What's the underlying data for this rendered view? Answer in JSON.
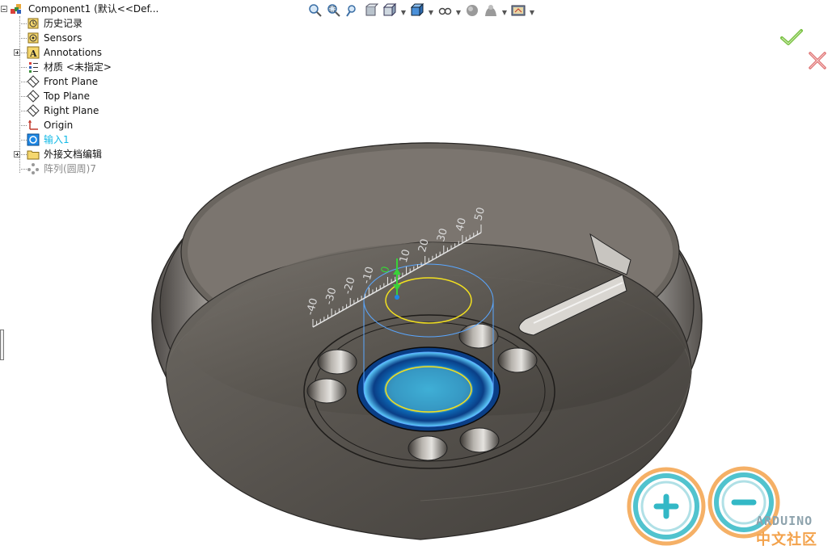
{
  "tree": {
    "root": "Component1  (默认<<Def...",
    "items": [
      {
        "label": "历史记录",
        "icon": "history-icon"
      },
      {
        "label": "Sensors",
        "icon": "sensors-icon"
      },
      {
        "label": "Annotations",
        "icon": "annotations-icon",
        "expandable": true
      },
      {
        "label": "材质 <未指定>",
        "icon": "material-icon"
      },
      {
        "label": "Front Plane",
        "icon": "plane-icon"
      },
      {
        "label": "Top Plane",
        "icon": "plane-icon"
      },
      {
        "label": "Right Plane",
        "icon": "plane-icon"
      },
      {
        "label": "Origin",
        "icon": "origin-icon"
      },
      {
        "label": "输入1",
        "icon": "imported-body-icon",
        "state": "selected"
      },
      {
        "label": "外接文档编辑",
        "icon": "folder-icon",
        "expandable": true
      },
      {
        "label": "阵列(圆周)7",
        "icon": "circular-pattern-icon",
        "state": "suppressed"
      }
    ]
  },
  "toolbar": [
    "zoom-to-fit-icon",
    "zoom-to-area-icon",
    "previous-view-icon",
    "section-view-icon",
    "view-orientation-icon",
    "display-style-icon",
    "hide-show-items-icon",
    "edit-appearance-icon",
    "apply-scene-icon",
    "view-settings-icon"
  ],
  "ruler": {
    "ticks": [
      "-40",
      "-30",
      "-20",
      "-10",
      "0",
      "10",
      "20",
      "30",
      "40",
      "50"
    ],
    "current": "0"
  },
  "logo": {
    "line1": "ARDUINO",
    "line2": "中文社区"
  },
  "colors": {
    "accent": "#12b9e6",
    "ok": "#7ac143",
    "cancel": "#e07a7a",
    "body": "#5b5753",
    "logo_teal": "#33b8c6",
    "logo_orange": "#f3a24b"
  }
}
